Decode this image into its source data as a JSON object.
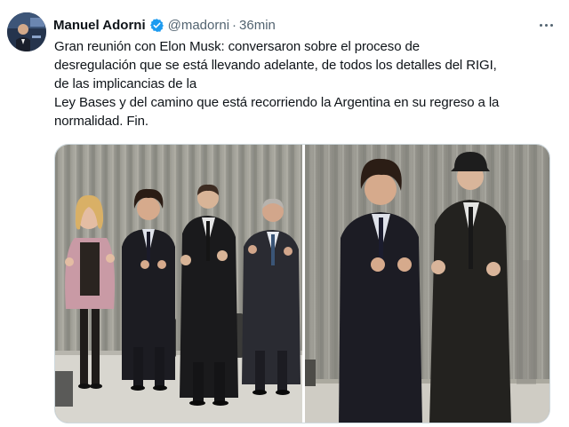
{
  "author": {
    "name": "Manuel Adorni",
    "handle": "@madorni",
    "separator": "·",
    "time": "36min",
    "verified_color": "#1d9bf0"
  },
  "tweet": {
    "lines": [
      "Gran reunión con Elon Musk: conversaron sobre el proceso de",
      "desregulación que se está llevando adelante, de todos los detalles del RIGI,",
      "de las implicancias de la",
      "Ley Bases y del camino que está recorriendo la Argentina en su regreso a la",
      "normalidad. Fin."
    ]
  },
  "icons": {
    "avatar": "avatar-photo",
    "verified": "verified-badge-icon",
    "more": "more-options-icon"
  },
  "media": {
    "count": 2,
    "items": [
      "group-photo",
      "two-men-photo"
    ]
  }
}
